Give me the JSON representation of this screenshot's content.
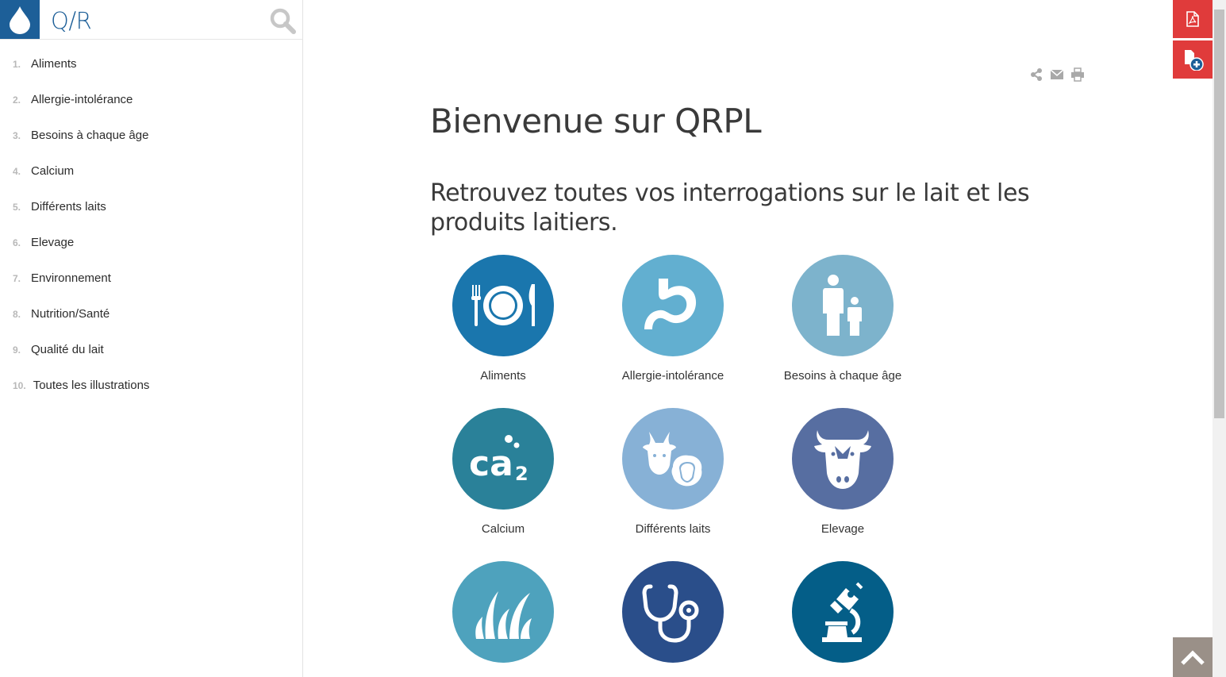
{
  "app": {
    "title": "Q/R"
  },
  "nav": [
    {
      "num": "1.",
      "label": "Aliments"
    },
    {
      "num": "2.",
      "label": "Allergie-intolérance"
    },
    {
      "num": "3.",
      "label": "Besoins à chaque âge"
    },
    {
      "num": "4.",
      "label": "Calcium"
    },
    {
      "num": "5.",
      "label": "Différents laits"
    },
    {
      "num": "6.",
      "label": "Elevage"
    },
    {
      "num": "7.",
      "label": "Environnement"
    },
    {
      "num": "8.",
      "label": "Nutrition/Santé"
    },
    {
      "num": "9.",
      "label": "Qualité du lait"
    },
    {
      "num": "10.",
      "label": "Toutes les illustrations"
    }
  ],
  "main": {
    "title": "Bienvenue sur QRPL",
    "subtitle": "Retrouvez toutes vos interrogations sur le lait et les produits laitiers."
  },
  "tiles": [
    {
      "label": "Aliments",
      "icon": "plate-cutlery-icon",
      "color": "#1a76ad"
    },
    {
      "label": "Allergie-intolérance",
      "icon": "stomach-icon",
      "color": "#62afd0"
    },
    {
      "label": "Besoins à chaque âge",
      "icon": "adult-child-icon",
      "color": "#7db3cc"
    },
    {
      "label": "Calcium",
      "icon": "calcium-icon",
      "color": "#2a8199"
    },
    {
      "label": "Différents laits",
      "icon": "goat-sheep-icon",
      "color": "#87b1d6"
    },
    {
      "label": "Elevage",
      "icon": "cow-icon",
      "color": "#576ea1"
    },
    {
      "label": "",
      "icon": "grass-icon",
      "color": "#4ea2bd"
    },
    {
      "label": "",
      "icon": "stethoscope-icon",
      "color": "#2a4e8a"
    },
    {
      "label": "",
      "icon": "microscope-icon",
      "color": "#045e88"
    }
  ],
  "tile_text": {
    "ca": "ca",
    "sub": "2"
  },
  "colors": {
    "brand": "#1d5f98",
    "action_red": "#e03b3b",
    "to_top": "#9a9088"
  }
}
